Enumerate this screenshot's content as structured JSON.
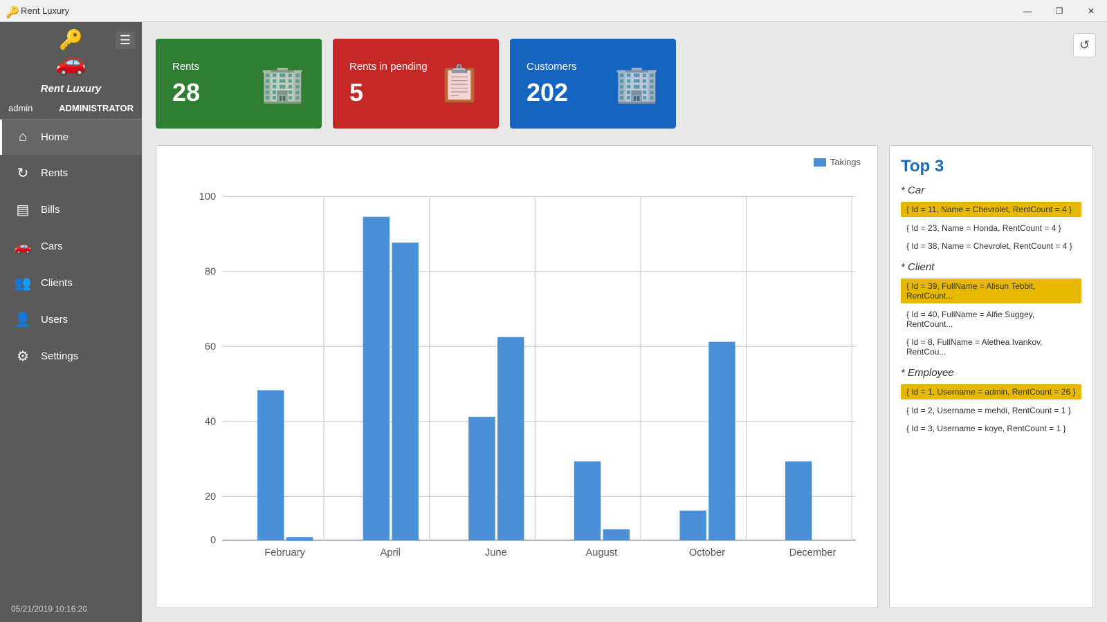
{
  "titlebar": {
    "title": "Rent Luxury",
    "min_btn": "🗕",
    "max_btn": "🗗",
    "close_btn": "✕"
  },
  "sidebar": {
    "brand": "Rent Luxury",
    "user": {
      "name": "admin",
      "role": "ADMINISTRATOR"
    },
    "nav_items": [
      {
        "id": "home",
        "label": "Home",
        "icon": "⌂",
        "active": true
      },
      {
        "id": "rents",
        "label": "Rents",
        "icon": "↻",
        "active": false
      },
      {
        "id": "bills",
        "label": "Bills",
        "icon": "▤",
        "active": false
      },
      {
        "id": "cars",
        "label": "Cars",
        "icon": "🚗",
        "active": false
      },
      {
        "id": "clients",
        "label": "Clients",
        "icon": "👥",
        "active": false
      },
      {
        "id": "users",
        "label": "Users",
        "icon": "👤",
        "active": false
      },
      {
        "id": "settings",
        "label": "Settings",
        "icon": "⚙",
        "active": false
      }
    ],
    "footer_datetime": "05/21/2019 10:16:20"
  },
  "stats": [
    {
      "id": "rents",
      "label": "Rents",
      "value": "28",
      "color": "green",
      "icon": "🏢"
    },
    {
      "id": "rents_pending",
      "label": "Rents in pending",
      "value": "5",
      "color": "red",
      "icon": "📋"
    },
    {
      "id": "customers",
      "label": "Customers",
      "value": "202",
      "color": "blue",
      "icon": "🏢"
    }
  ],
  "chart": {
    "title": "Takings",
    "legend_label": "Takings",
    "y_max": 100,
    "y_labels": [
      "0",
      "20",
      "40",
      "60",
      "80",
      "100"
    ],
    "x_labels": [
      "February",
      "April",
      "June",
      "August",
      "October",
      "December"
    ],
    "bars": [
      {
        "month": "February",
        "value": 40
      },
      {
        "month": "February2",
        "value": 1
      },
      {
        "month": "April",
        "value": 86
      },
      {
        "month": "April2",
        "value": 79
      },
      {
        "month": "June",
        "value": 33
      },
      {
        "month": "June2",
        "value": 54
      },
      {
        "month": "August",
        "value": 21
      },
      {
        "month": "August2",
        "value": 3
      },
      {
        "month": "October",
        "value": 8
      },
      {
        "month": "October2",
        "value": 53
      },
      {
        "month": "December",
        "value": 21
      },
      {
        "month": "December2",
        "value": 0
      }
    ]
  },
  "top3": {
    "title": "Top 3",
    "sections": [
      {
        "id": "car",
        "label": "Car",
        "items": [
          {
            "text": "{ Id = 11, Name = Chevrolet, RentCount = 4 }",
            "highlighted": true
          },
          {
            "text": "{ Id = 23, Name = Honda, RentCount = 4 }",
            "highlighted": false
          },
          {
            "text": "{ Id = 38, Name = Chevrolet, RentCount = 4 }",
            "highlighted": false
          }
        ]
      },
      {
        "id": "client",
        "label": "Client",
        "items": [
          {
            "text": "{ Id = 39, FullName = Alisun Tebbit, RentCount...",
            "highlighted": true
          },
          {
            "text": "{ Id = 40, FullName = Alfie Suggey, RentCount...",
            "highlighted": false
          },
          {
            "text": "{ Id = 8, FullName = Alethea Ivankov, RentCou...",
            "highlighted": false
          }
        ]
      },
      {
        "id": "employee",
        "label": "Employee",
        "items": [
          {
            "text": "{ Id = 1, Username = admin, RentCount = 26 }",
            "highlighted": true
          },
          {
            "text": "{ Id = 2, Username = mehdi, RentCount = 1 }",
            "highlighted": false
          },
          {
            "text": "{ Id = 3, Username = koye, RentCount = 1 }",
            "highlighted": false
          }
        ]
      }
    ]
  }
}
